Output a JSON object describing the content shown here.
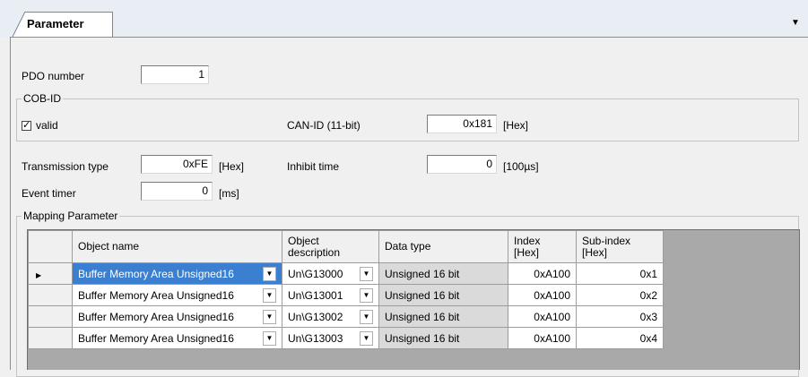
{
  "tab": {
    "label": "Parameter"
  },
  "pdo": {
    "label": "PDO number",
    "value": "1"
  },
  "cobid": {
    "group_title": "COB-ID",
    "valid_label": "valid",
    "valid_checked": true,
    "canid_label": "CAN-ID (11-bit)",
    "canid_value": "0x181",
    "canid_unit": "[Hex]"
  },
  "transmission": {
    "label": "Transmission type",
    "value": "0xFE",
    "unit": "[Hex]"
  },
  "inhibit": {
    "label": "Inhibit time",
    "value": "0",
    "unit": "[100µs]"
  },
  "event": {
    "label": "Event timer",
    "value": "0",
    "unit": "[ms]"
  },
  "mapping": {
    "group_title": "Mapping Parameter",
    "columns": [
      "Object name",
      "Object\ndescription",
      "Data type",
      "Index\n[Hex]",
      "Sub-index\n[Hex]"
    ],
    "col_labels": {
      "object_name": "Object name",
      "object_desc_1": "Object",
      "object_desc_2": "description",
      "data_type": "Data type",
      "index_1": "Index",
      "index_2": "[Hex]",
      "subindex_1": "Sub-index",
      "subindex_2": "[Hex]"
    },
    "rows": [
      {
        "name": "Buffer Memory Area Unsigned16",
        "desc": "Un\\G13000",
        "type": "Unsigned 16 bit",
        "index": "0xA100",
        "subindex": "0x1"
      },
      {
        "name": "Buffer Memory Area Unsigned16",
        "desc": "Un\\G13001",
        "type": "Unsigned 16 bit",
        "index": "0xA100",
        "subindex": "0x2"
      },
      {
        "name": "Buffer Memory Area Unsigned16",
        "desc": "Un\\G13002",
        "type": "Unsigned 16 bit",
        "index": "0xA100",
        "subindex": "0x3"
      },
      {
        "name": "Buffer Memory Area Unsigned16",
        "desc": "Un\\G13003",
        "type": "Unsigned 16 bit",
        "index": "0xA100",
        "subindex": "0x4"
      }
    ]
  },
  "icons": {
    "dropdown": "chevron-down-icon",
    "row_pointer": "row-pointer-icon",
    "check": "checkmark-icon"
  },
  "colors": {
    "selection": "#3a7fd0",
    "readonly_cell": "#dadada"
  }
}
